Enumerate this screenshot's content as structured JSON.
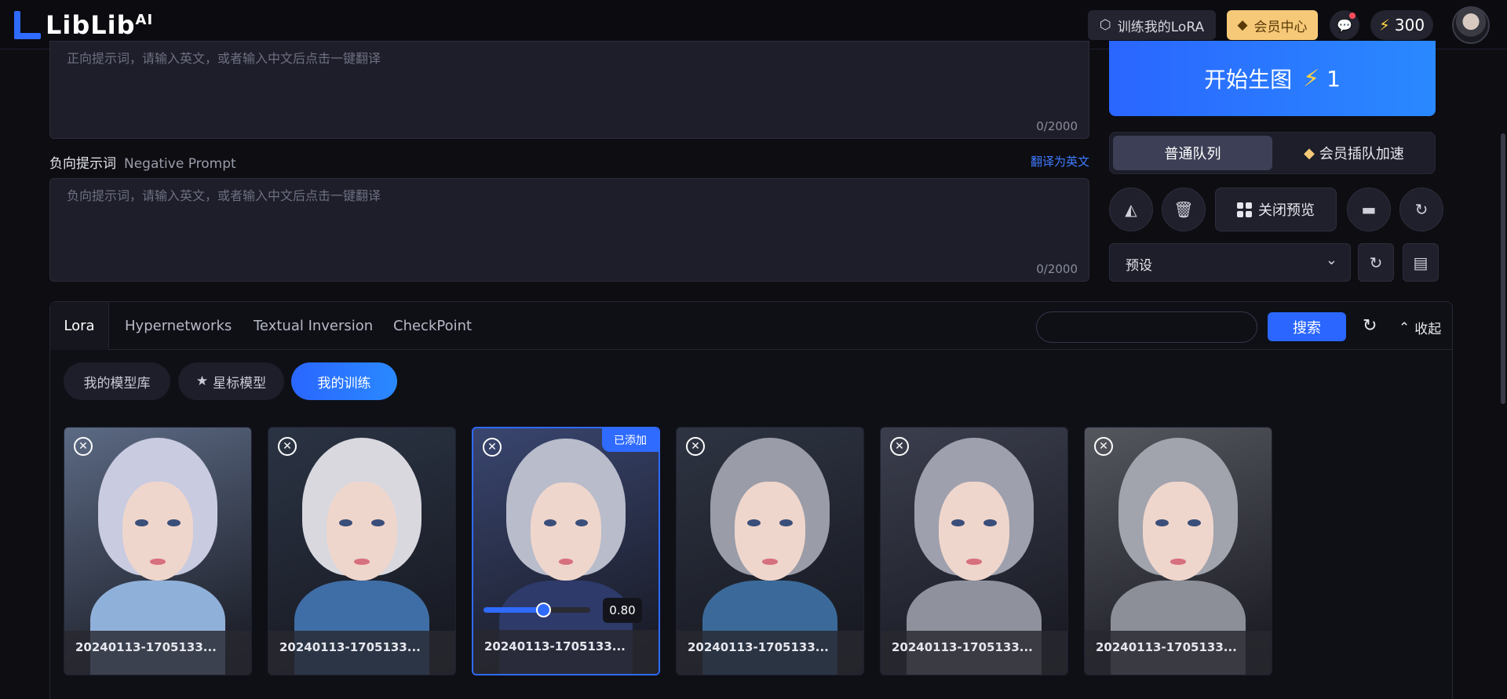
{
  "header": {
    "logo_text": "LibLib",
    "logo_sup": "AI",
    "train_lora": "训练我的LoRA",
    "member_center": "会员中心",
    "points": "300"
  },
  "prompt": {
    "positive_placeholder": "正向提示词，请输入英文，或者输入中文后点击一键翻译",
    "positive_count": "0/2000",
    "negative_label": "负向提示词",
    "negative_label_en": "Negative Prompt",
    "translate_link": "翻译为英文",
    "negative_placeholder": "负向提示词，请输入英文，或者输入中文后点击一键翻译",
    "negative_count": "0/2000"
  },
  "right_panel": {
    "generate_label": "开始生图",
    "generate_cost": "1",
    "queue_normal": "普通队列",
    "queue_vip": "会员插队加速",
    "close_preview": "关闭预览",
    "preset_value": "预设"
  },
  "models": {
    "tabs": [
      {
        "label": "Lora",
        "active": true
      },
      {
        "label": "Hypernetworks",
        "active": false
      },
      {
        "label": "Textual Inversion",
        "active": false
      },
      {
        "label": "CheckPoint",
        "active": false
      }
    ],
    "search_button": "搜索",
    "collapse_label": "收起",
    "filters": [
      "我的模型库",
      "星标模型",
      "我的训练"
    ],
    "cards": [
      {
        "name": "20240113-1705133...",
        "hair": "#c9cbe0",
        "bg": "#5c6a84",
        "body": "#8fb0d9",
        "selected": false
      },
      {
        "name": "20240113-1705133...",
        "hair": "#d8d8de",
        "bg": "#2b3444",
        "body": "#3f6ea6",
        "selected": false
      },
      {
        "name": "20240113-1705133...",
        "hair": "#b8bccb",
        "bg": "#3a4670",
        "body": "#2d3a6a",
        "selected": true,
        "badge": "已添加",
        "weight": "0.80",
        "weight_fraction": 0.56
      },
      {
        "name": "20240113-1705133...",
        "hair": "#9a9ca8",
        "bg": "#2e3442",
        "body": "#3b6a9a",
        "selected": false
      },
      {
        "name": "20240113-1705133...",
        "hair": "#9ea0ad",
        "bg": "#3b3e4d",
        "body": "#8f919c",
        "selected": false
      },
      {
        "name": "20240113-1705133...",
        "hair": "#a1a3ad",
        "bg": "#55575f",
        "body": "#8d8f98",
        "selected": false
      }
    ]
  },
  "colors": {
    "accent": "#2a66ff",
    "gold": "#f6c978",
    "bolt": "#ffd23f"
  }
}
